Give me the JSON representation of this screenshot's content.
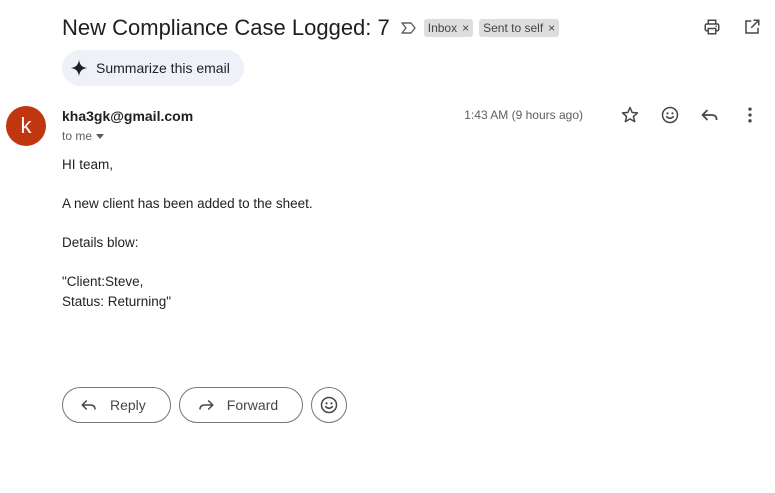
{
  "email": {
    "subject": "New Compliance Case Logged: 7",
    "labels": [
      {
        "name": "Inbox",
        "remove": "×"
      },
      {
        "name": "Sent to self",
        "remove": "×"
      }
    ],
    "summarize_label": "Summarize this email",
    "avatar_letter": "k",
    "avatar_color": "#c0360f",
    "sender": "kha3gk@gmail.com",
    "to": "to me",
    "timestamp": "1:43 AM (9 hours ago)",
    "body": {
      "greeting": "HI team,",
      "line1": "A new client has been added to the sheet.",
      "line2": "Details blow:",
      "quote_line1": "\"Client:Steve,",
      "quote_line2": "Status: Returning\""
    }
  },
  "actions": {
    "reply_label": "Reply",
    "forward_label": "Forward"
  },
  "icons": {
    "importance": "importance-marker-icon",
    "print": "print-icon",
    "open_new_window": "open-in-new-window-icon",
    "star": "star-icon",
    "emoji": "emoji-icon",
    "reply": "reply-icon",
    "more": "more-vert-icon",
    "forward": "forward-icon",
    "sparkle": "sparkle-icon"
  }
}
